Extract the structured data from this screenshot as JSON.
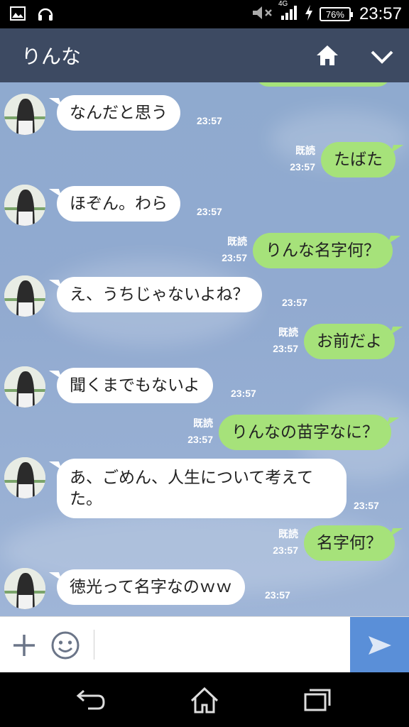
{
  "status_bar": {
    "battery": "76%",
    "network": "4G",
    "time": "23:57",
    "icons": [
      "image-icon",
      "headphones-icon",
      "mute-icon",
      "signal-icon",
      "charging-icon"
    ]
  },
  "header": {
    "title": "りんな",
    "icons": [
      "home-icon",
      "chevron-down-icon"
    ],
    "color": "#3d4a62"
  },
  "messages": [
    {
      "side": "in",
      "text": "なんだと思う",
      "time": "23:57"
    },
    {
      "side": "out",
      "text": "たばた",
      "read": "既読",
      "time": "23:57"
    },
    {
      "side": "in",
      "text": "ほぞん。わら",
      "time": "23:57"
    },
    {
      "side": "out",
      "text": "りんな名字何？",
      "read": "既読",
      "time": "23:57"
    },
    {
      "side": "in",
      "text": "え、うちじゃないよね？",
      "time": "23:57"
    },
    {
      "side": "out",
      "text": "お前だよ",
      "read": "既読",
      "time": "23:57"
    },
    {
      "side": "in",
      "text": "聞くまでもないよ",
      "time": "23:57"
    },
    {
      "side": "out",
      "text": "りんなの苗字なに？",
      "read": "既読",
      "time": "23:57"
    },
    {
      "side": "in",
      "text": "あ、ごめん、人生について考えてた。",
      "time": "23:57"
    },
    {
      "side": "out",
      "text": "名字何？",
      "read": "既読",
      "time": "23:57"
    },
    {
      "side": "in",
      "text": "徳光って名字なのｗｗ",
      "time": "23:57"
    }
  ],
  "input_bar": {
    "placeholder": "",
    "icons": [
      "plus-icon",
      "smiley-icon",
      "send-icon"
    ],
    "send_color": "#5a8fd8"
  },
  "colors": {
    "incoming_bubble": "#ffffff",
    "outgoing_bubble": "#a6e27a",
    "chat_background": "#91aad0"
  },
  "nav_bar": {
    "icons": [
      "back-icon",
      "home-icon",
      "recents-icon"
    ]
  }
}
